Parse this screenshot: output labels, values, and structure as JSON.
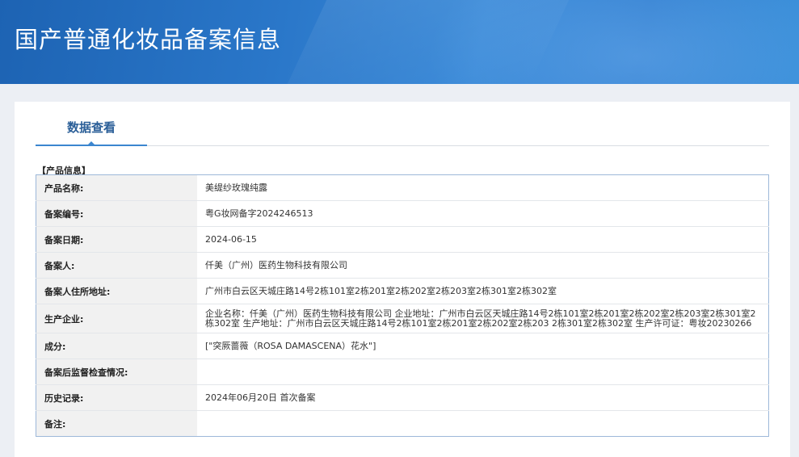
{
  "header": {
    "title": "国产普通化妆品备案信息"
  },
  "tabs": [
    {
      "label": "数据查看"
    }
  ],
  "section": {
    "label": "【产品信息】"
  },
  "rows": [
    {
      "key": "产品名称:",
      "value": "美缇纱玫瑰纯露"
    },
    {
      "key": "备案编号:",
      "value": "粤G妆网备字2024246513"
    },
    {
      "key": "备案日期:",
      "value": "2024-06-15"
    },
    {
      "key": "备案人:",
      "value": "仟美（广州）医药生物科技有限公司"
    },
    {
      "key": "备案人住所地址:",
      "value": "广州市白云区天城庄路14号2栋101室2栋201室2栋202室2栋203室2栋301室2栋302室"
    },
    {
      "key": "生产企业:",
      "value": "企业名称：仟美（广州）医药生物科技有限公司 企业地址：广州市白云区天城庄路14号2栋101室2栋201室2栋202室2栋203室2栋301室2栋302室 生产地址：广州市白云区天城庄路14号2栋101室2栋201室2栋202室2栋203 2栋301室2栋302室 生产许可证：粤妆20230266"
    },
    {
      "key": "成分:",
      "value": "[\"突厥蔷薇（ROSA DAMASCENA）花水\"]"
    },
    {
      "key": "备案后监督检查情况:",
      "value": ""
    },
    {
      "key": "历史记录:",
      "value": "2024年06月20日 首次备案"
    },
    {
      "key": "备注:",
      "value": ""
    }
  ]
}
